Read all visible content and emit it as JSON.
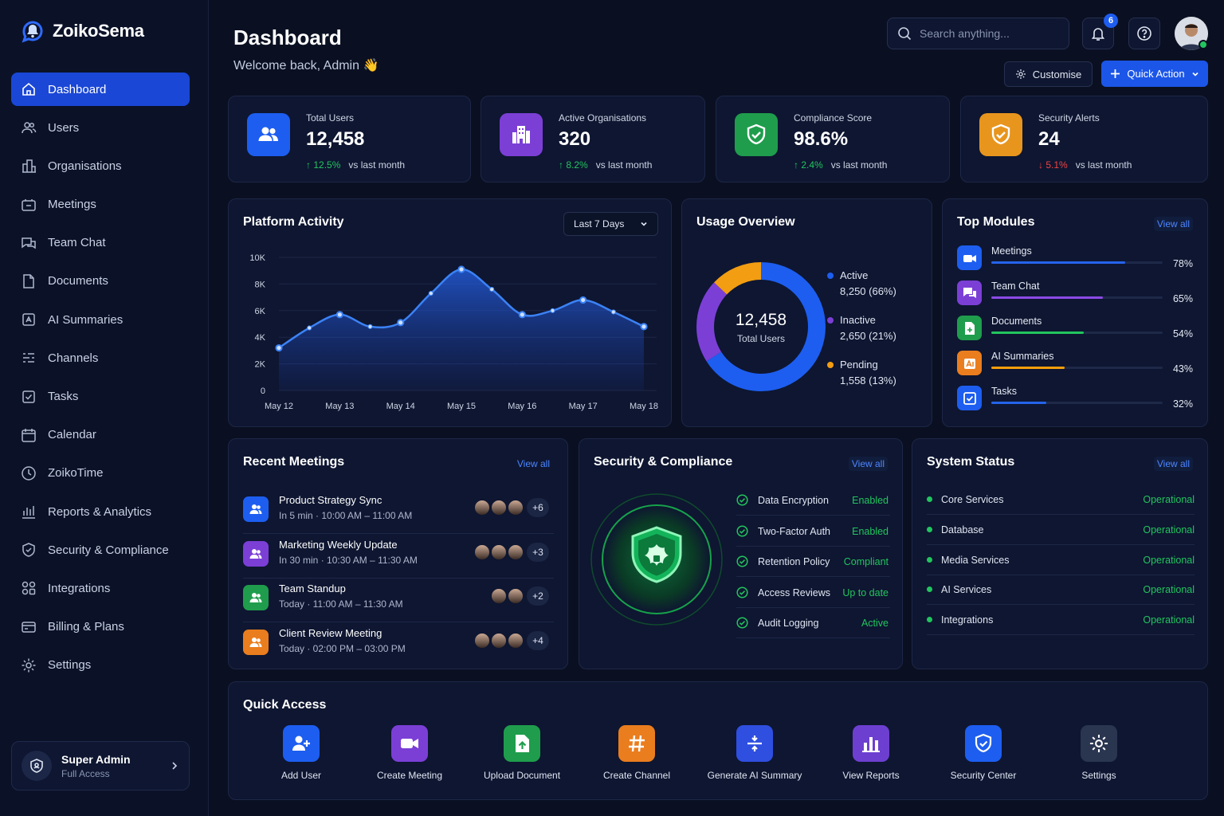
{
  "app": {
    "name": "ZoikoSema"
  },
  "sidebar": {
    "items": [
      {
        "label": "Dashboard",
        "icon": "home-icon"
      },
      {
        "label": "Users",
        "icon": "users-icon"
      },
      {
        "label": "Organisations",
        "icon": "building-icon"
      },
      {
        "label": "Meetings",
        "icon": "meetings-icon"
      },
      {
        "label": "Team Chat",
        "icon": "chat-icon"
      },
      {
        "label": "Documents",
        "icon": "document-icon"
      },
      {
        "label": "AI Summaries",
        "icon": "ai-icon"
      },
      {
        "label": "Channels",
        "icon": "channels-icon"
      },
      {
        "label": "Tasks",
        "icon": "tasks-icon"
      },
      {
        "label": "Calendar",
        "icon": "calendar-icon"
      },
      {
        "label": "ZoikoTime",
        "icon": "clock-icon"
      },
      {
        "label": "Reports & Analytics",
        "icon": "reports-icon"
      },
      {
        "label": "Security & Compliance",
        "icon": "shield-icon"
      },
      {
        "label": "Integrations",
        "icon": "integrations-icon"
      },
      {
        "label": "Billing & Plans",
        "icon": "billing-icon"
      },
      {
        "label": "Settings",
        "icon": "settings-icon"
      }
    ],
    "user": {
      "name": "Super Admin",
      "role": "Full Access"
    }
  },
  "header": {
    "title": "Dashboard",
    "subtitle": "Welcome back, Admin 👋",
    "search_placeholder": "Search anything...",
    "notifications": "6",
    "customise": "Customise",
    "quick_action": "Quick Action"
  },
  "stats": [
    {
      "label": "Total Users",
      "value": "12,458",
      "change": "12.5%",
      "direction": "up",
      "note": "vs last month",
      "color": "#1d5ef0"
    },
    {
      "label": "Active Organisations",
      "value": "320",
      "change": "8.2%",
      "direction": "up",
      "note": "vs last month",
      "color": "#7b3fd6"
    },
    {
      "label": "Compliance Score",
      "value": "98.6%",
      "change": "2.4%",
      "direction": "up",
      "note": "vs last month",
      "color": "#1f9d4c"
    },
    {
      "label": "Security Alerts",
      "value": "24",
      "change": "5.1%",
      "direction": "down",
      "note": "vs last month",
      "color": "#e8951e"
    }
  ],
  "activity": {
    "title": "Platform Activity",
    "range": "Last 7 Days"
  },
  "chart_data": {
    "type": "area",
    "x": [
      "May 12",
      "May 13",
      "May 14",
      "May 15",
      "May 16",
      "May 17",
      "May 18"
    ],
    "y_ticks": [
      "10K",
      "8K",
      "6K",
      "4K",
      "2K",
      "0"
    ],
    "ylim": [
      0,
      10000
    ],
    "points": [
      [
        0,
        3200
      ],
      [
        0.5,
        4700
      ],
      [
        1,
        5700
      ],
      [
        1.5,
        4800
      ],
      [
        2,
        5100
      ],
      [
        2.5,
        7300
      ],
      [
        3,
        9100
      ],
      [
        3.5,
        7600
      ],
      [
        4,
        5700
      ],
      [
        4.5,
        6000
      ],
      [
        5,
        6800
      ],
      [
        5.5,
        5900
      ],
      [
        6,
        4800
      ]
    ]
  },
  "usage": {
    "title": "Usage Overview",
    "total": "12,458",
    "total_label": "Total Users",
    "segments": [
      {
        "label": "Active",
        "value": "8,250 (66%)",
        "pct": 66,
        "color": "#1d5ef0"
      },
      {
        "label": "Inactive",
        "value": "2,650 (21%)",
        "pct": 21,
        "color": "#7b3fd6"
      },
      {
        "label": "Pending",
        "value": "1,558 (13%)",
        "pct": 13,
        "color": "#f29d12"
      }
    ]
  },
  "modules": {
    "title": "Top Modules",
    "view_all": "View all",
    "items": [
      {
        "name": "Meetings",
        "pct": 78,
        "label": "78%",
        "color": "#1d5ef0",
        "bar": "#2563eb"
      },
      {
        "name": "Team Chat",
        "pct": 65,
        "label": "65%",
        "color": "#7b3fd6",
        "bar": "#8b4ae6"
      },
      {
        "name": "Documents",
        "pct": 54,
        "label": "54%",
        "color": "#1f9d4c",
        "bar": "#22c55e"
      },
      {
        "name": "AI Summaries",
        "pct": 43,
        "label": "43%",
        "color": "#ea7d1e",
        "bar": "#f59e0b"
      },
      {
        "name": "Tasks",
        "pct": 32,
        "label": "32%",
        "color": "#1d5ef0",
        "bar": "#2563eb"
      }
    ]
  },
  "meetings": {
    "title": "Recent Meetings",
    "view_all": "View all",
    "items": [
      {
        "title": "Product Strategy Sync",
        "time": "In 5 min · 10:00 AM – 11:00 AM",
        "more": "+6",
        "avatars": 3,
        "color": "#1d5ef0"
      },
      {
        "title": "Marketing Weekly Update",
        "time": "In 30 min · 10:30 AM – 11:30 AM",
        "more": "+3",
        "avatars": 3,
        "color": "#7b3fd6"
      },
      {
        "title": "Team Standup",
        "time": "Today · 11:00 AM – 11:30 AM",
        "more": "+2",
        "avatars": 2,
        "color": "#1f9d4c"
      },
      {
        "title": "Client Review Meeting",
        "time": "Today · 02:00 PM – 03:00 PM",
        "more": "+4",
        "avatars": 3,
        "color": "#ea7d1e"
      }
    ]
  },
  "security": {
    "title": "Security & Compliance",
    "view_all": "View all",
    "items": [
      {
        "name": "Data Encryption",
        "status": "Enabled"
      },
      {
        "name": "Two-Factor Auth",
        "status": "Enabled"
      },
      {
        "name": "Retention Policy",
        "status": "Compliant"
      },
      {
        "name": "Access Reviews",
        "status": "Up to date"
      },
      {
        "name": "Audit Logging",
        "status": "Active"
      }
    ]
  },
  "system": {
    "title": "System Status",
    "view_all": "View all",
    "items": [
      {
        "name": "Core Services",
        "status": "Operational"
      },
      {
        "name": "Database",
        "status": "Operational"
      },
      {
        "name": "Media Services",
        "status": "Operational"
      },
      {
        "name": "AI Services",
        "status": "Operational"
      },
      {
        "name": "Integrations",
        "status": "Operational"
      }
    ]
  },
  "quick": {
    "title": "Quick Access",
    "items": [
      {
        "label": "Add User",
        "color": "#1d5ef0"
      },
      {
        "label": "Create Meeting",
        "color": "#7b3fd6"
      },
      {
        "label": "Upload Document",
        "color": "#1f9d4c"
      },
      {
        "label": "Create Channel",
        "color": "#ea7d1e"
      },
      {
        "label": "Generate AI Summary",
        "color": "#2f4fe0"
      },
      {
        "label": "View Reports",
        "color": "#6d3fd0"
      },
      {
        "label": "Security Center",
        "color": "#1d5ef0"
      },
      {
        "label": "Settings",
        "color": "#2a3550"
      }
    ]
  }
}
